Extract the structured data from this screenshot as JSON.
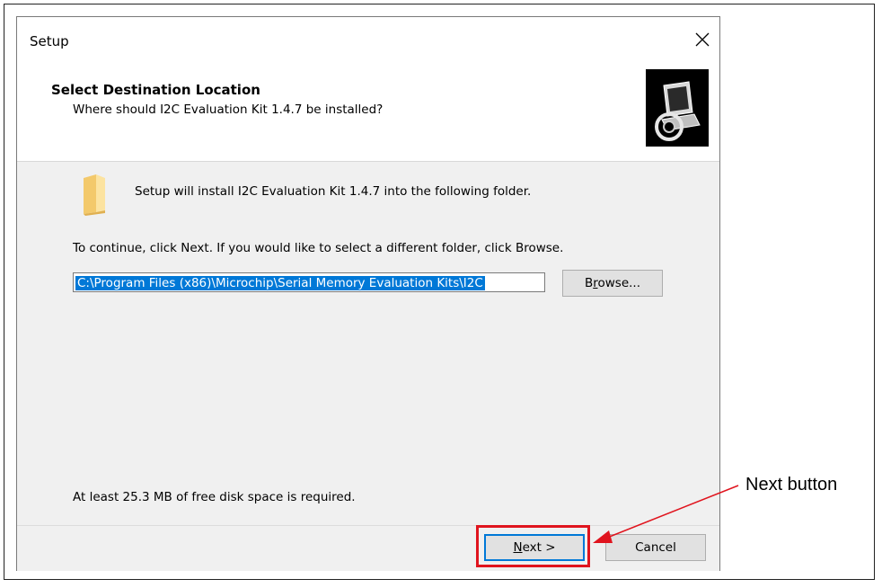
{
  "window": {
    "title": "Setup",
    "close_icon": "close-icon"
  },
  "header": {
    "title": "Select Destination Location",
    "subtitle": "Where should I2C Evaluation Kit 1.4.7 be installed?",
    "image_icon": "computer-install-icon"
  },
  "body": {
    "folder_icon": "folder-icon",
    "install_message": "Setup will install I2C Evaluation Kit 1.4.7 into the following folder.",
    "continue_message": "To continue, click Next. If you would like to select a different folder, click Browse.",
    "path_value": "C:\\Program Files (x86)\\Microchip\\Serial Memory Evaluation Kits\\I2C",
    "browse_label_pre": "B",
    "browse_label_u": "r",
    "browse_label_post": "owse...",
    "disk_space_message": "At least 25.3 MB of free disk space is required."
  },
  "footer": {
    "next_label_u": "N",
    "next_label_post": "ext >",
    "cancel_label": "Cancel"
  },
  "annotation": {
    "label": "Next button",
    "highlight_color": "#e0141e"
  }
}
